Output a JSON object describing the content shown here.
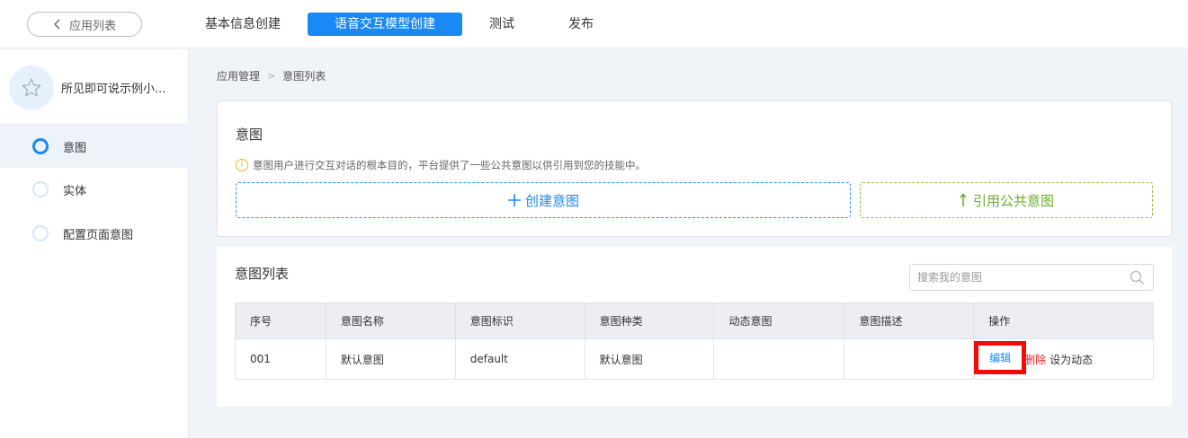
{
  "topbar": {
    "back_label": "应用列表",
    "steps": [
      {
        "label": "基本信息创建",
        "active": false
      },
      {
        "label": "语音交互模型创建",
        "active": true
      },
      {
        "label": "测试",
        "active": false
      },
      {
        "label": "发布",
        "active": false
      }
    ]
  },
  "sidebar": {
    "app_name": "所见即可说示例小...",
    "app_icon": "star-outline-icon",
    "items": [
      {
        "label": "意图",
        "active": true
      },
      {
        "label": "实体",
        "active": false
      },
      {
        "label": "配置页面意图",
        "active": false
      }
    ]
  },
  "breadcrumb": {
    "root": "应用管理",
    "sep": ">",
    "current": "意图列表"
  },
  "intent_card": {
    "title": "意图",
    "tip": "意图用户进行交互对话的根本目的，平台提供了一些公共意图以供引用到您的技能中。",
    "create_label": "创建意图",
    "public_label": "引用公共意图"
  },
  "list_card": {
    "title": "意图列表",
    "search_placeholder": "搜索我的意图",
    "columns": [
      "序号",
      "意图名称",
      "意图标识",
      "意图种类",
      "动态意图",
      "意图描述",
      "操作"
    ],
    "rows": [
      {
        "index": "001",
        "name": "默认意图",
        "id": "default",
        "kind": "默认意图",
        "dynamic": "",
        "desc": "",
        "actions": {
          "edit": "编辑",
          "delete": "删除",
          "set_dynamic": "设为动态"
        }
      }
    ]
  },
  "colors": {
    "primary": "#1a88f5",
    "green": "#6aab2e",
    "danger": "#e8262c",
    "highlight": "#f50909",
    "warning": "#f0b41e"
  }
}
